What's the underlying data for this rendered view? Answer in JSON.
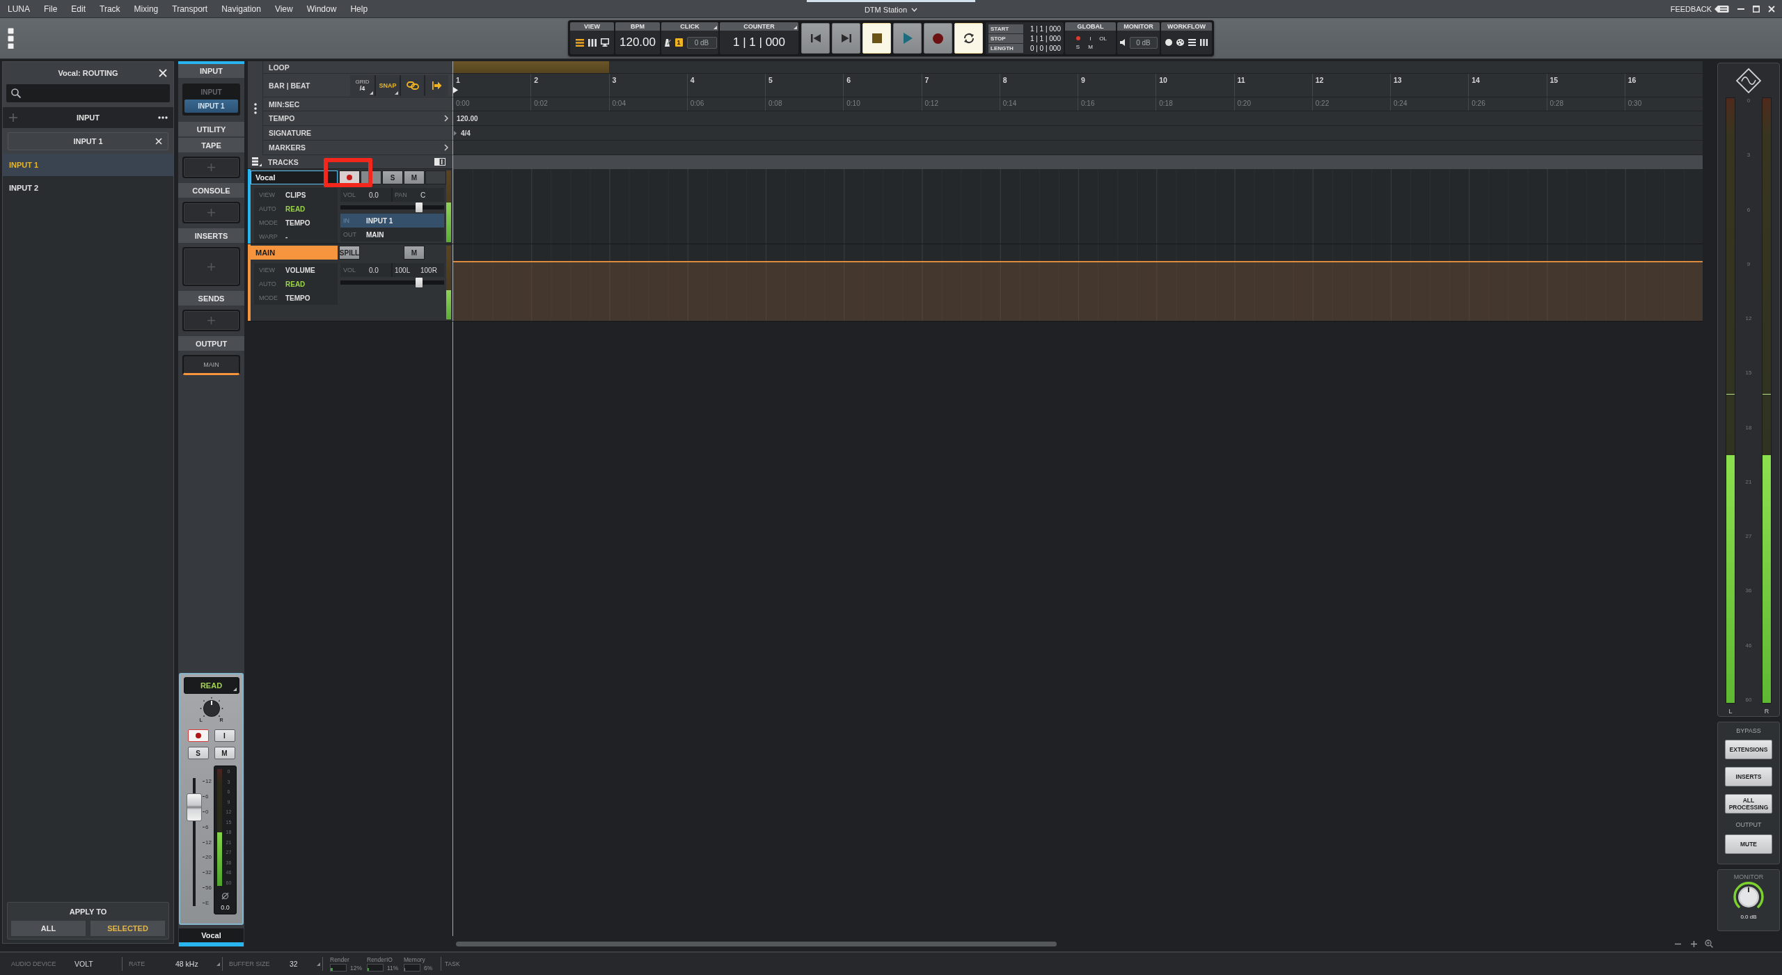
{
  "menu_bar": {
    "app": "LUNA",
    "items": [
      "File",
      "Edit",
      "Track",
      "Mixing",
      "Transport",
      "Navigation",
      "View",
      "Window",
      "Help"
    ],
    "session_title": "DTM Station",
    "feedback": "FEEDBACK"
  },
  "transport": {
    "sections": {
      "view": "VIEW",
      "bpm": "BPM",
      "click": "CLICK",
      "counter": "COUNTER",
      "global": "GLOBAL",
      "monitor": "MONITOR",
      "workflow": "WORKFLOW"
    },
    "bpm": "120.00",
    "click_count": "1",
    "click_level": "0 dB",
    "counter": "1 | 1 | 000",
    "buttons": [
      {
        "kind": "to_start",
        "on": false
      },
      {
        "kind": "to_end",
        "on": false
      },
      {
        "kind": "stop",
        "on": true
      },
      {
        "kind": "play",
        "on": false
      },
      {
        "kind": "record",
        "on": false
      },
      {
        "kind": "loop",
        "on": true
      }
    ],
    "range": [
      {
        "label": "START",
        "value": "1 | 1 | 000"
      },
      {
        "label": "STOP",
        "value": "1 | 1 | 000"
      },
      {
        "label": "LENGTH",
        "value": "0 | 0 | 000"
      }
    ],
    "global": {
      "top": [
        "I",
        "OL"
      ],
      "bottom": [
        "S",
        "M"
      ]
    },
    "monitor_level": "0 dB"
  },
  "routing": {
    "title": "Vocal: ROUTING",
    "group": "INPUT",
    "chosen": "INPUT 1",
    "items": [
      {
        "label": "INPUT 1",
        "selected": true
      },
      {
        "label": "INPUT 2",
        "selected": false
      }
    ],
    "apply_to": {
      "label": "APPLY TO",
      "options": [
        {
          "label": "ALL",
          "selected": false
        },
        {
          "label": "SELECTED",
          "selected": true
        }
      ]
    }
  },
  "inspector": {
    "sections": [
      {
        "kind": "selector",
        "title": "INPUT",
        "active": true,
        "options": [
          {
            "label": "INPUT",
            "selected": false
          },
          {
            "label": "INPUT 1",
            "selected": true
          }
        ]
      },
      {
        "kind": "header",
        "title": "UTILITY",
        "active": false
      },
      {
        "kind": "slot",
        "title": "TAPE",
        "active": false
      },
      {
        "kind": "slot",
        "title": "CONSOLE",
        "active": false
      },
      {
        "kind": "large_slot",
        "title": "INSERTS",
        "active": false
      },
      {
        "kind": "slot",
        "title": "SENDS",
        "active": false
      },
      {
        "kind": "output",
        "title": "OUTPUT",
        "active": false,
        "value": "MAIN"
      }
    ]
  },
  "channel_strip": {
    "automation": "READ",
    "pan_labels": [
      "L",
      "R"
    ],
    "buttons": [
      {
        "kind": "record"
      },
      {
        "kind": "label",
        "label": "I"
      },
      {
        "kind": "label",
        "label": "S"
      },
      {
        "kind": "label",
        "label": "M"
      }
    ],
    "fader_scale": [
      "12",
      "6",
      "0",
      "6",
      "12",
      "20",
      "32",
      "56",
      "E"
    ],
    "fader": {
      "level": 0.85
    },
    "meter_scale": [
      "0",
      "3",
      "6",
      "9",
      "12",
      "15",
      "18",
      "21",
      "27",
      "36",
      "46",
      "60"
    ],
    "meter": {
      "level": 0.46
    },
    "peak": "0.0",
    "name": "Vocal"
  },
  "ruler": {
    "rows": [
      {
        "kind": "loop",
        "label": "LOOP"
      },
      {
        "kind": "bars",
        "label": "BAR | BEAT",
        "values": [
          "1",
          "2",
          "3",
          "4",
          "5",
          "6",
          "7",
          "8",
          "9",
          "10",
          "11",
          "12",
          "13",
          "14",
          "15",
          "16"
        ]
      },
      {
        "kind": "times",
        "label": "MIN:SEC",
        "values": [
          "0:00",
          "0:02",
          "0:04",
          "0:06",
          "0:08",
          "0:10",
          "0:12",
          "0:14",
          "0:16",
          "0:18",
          "0:20",
          "0:22",
          "0:24",
          "0:26",
          "0:28",
          "0:30"
        ]
      },
      {
        "kind": "tempo",
        "label": "TEMPO",
        "values": [
          "120.00"
        ]
      },
      {
        "kind": "signature",
        "label": "SIGNATURE",
        "values": [
          "4/4"
        ]
      },
      {
        "kind": "markers",
        "label": "MARKERS"
      }
    ],
    "grid": {
      "label": "GRID",
      "value": "/4"
    },
    "snap": "SNAP"
  },
  "tracks_header": {
    "label": "TRACKS"
  },
  "tracks": [
    {
      "kind": "audio",
      "name": "Vocal",
      "color": "#29b6f0",
      "selected": true,
      "buttons": [
        {
          "kind": "record"
        },
        {
          "kind": "monitor"
        },
        {
          "kind": "solo",
          "label": "S"
        },
        {
          "kind": "mute",
          "label": "M"
        },
        {
          "kind": "blank"
        }
      ],
      "properties": [
        {
          "kind": "plain",
          "label": "VIEW",
          "value": "CLIPS"
        },
        {
          "kind": "automation",
          "label": "AUTO",
          "value": "READ"
        },
        {
          "kind": "plain",
          "label": "MODE",
          "value": "TEMPO"
        },
        {
          "kind": "plain",
          "label": "WARP",
          "value": "-"
        }
      ],
      "mix": [
        {
          "kind": "label",
          "text": "VOL"
        },
        {
          "kind": "value",
          "text": "0.0"
        },
        {
          "kind": "label",
          "text": "PAN"
        },
        {
          "kind": "value",
          "text": "C"
        }
      ],
      "volume": {
        "level": 0.78
      },
      "routing": [
        {
          "label": "IN",
          "value": "INPUT 1",
          "selected": true
        },
        {
          "label": "OUT",
          "value": "MAIN",
          "selected": false
        }
      ],
      "meter": {
        "level": 0.55
      }
    },
    {
      "kind": "main",
      "name": "MAIN",
      "color": "#f7953f",
      "selected": false,
      "buttons": [
        {
          "kind": "spill",
          "label": "SPILL"
        },
        {
          "kind": "mute",
          "label": "M"
        }
      ],
      "properties": [
        {
          "kind": "plain",
          "label": "VIEW",
          "value": "VOLUME"
        },
        {
          "kind": "automation",
          "label": "AUTO",
          "value": "READ"
        },
        {
          "kind": "plain",
          "label": "MODE",
          "value": "TEMPO"
        }
      ],
      "mix": [
        {
          "kind": "label",
          "text": "VOL"
        },
        {
          "kind": "value",
          "text": "0.0"
        },
        {
          "kind": "value",
          "text": "100L"
        },
        {
          "kind": "value",
          "text": "100R"
        }
      ],
      "volume": {
        "level": 0.78
      },
      "meter": {
        "level": 0.4
      }
    }
  ],
  "master": {
    "scale": [
      "0",
      "3",
      "6",
      "9",
      "12",
      "15",
      "18",
      "21",
      "27",
      "36",
      "46",
      "60"
    ],
    "meters": [
      {
        "label": "L",
        "level": 0.41
      },
      {
        "label": "R",
        "level": 0.41
      }
    ],
    "bypass": {
      "label": "BYPASS",
      "buttons": [
        "EXTENSIONS",
        "INSERTS",
        "ALL PROCESSING"
      ]
    },
    "output": {
      "label": "OUTPUT",
      "buttons": [
        "MUTE"
      ]
    },
    "monitor": {
      "label": "MONITOR",
      "value": "0.0 dB"
    }
  },
  "status_bar": {
    "fields": [
      {
        "kind": "plain",
        "label": "AUDIO DEVICE",
        "value": "VOLT"
      },
      {
        "kind": "dropdown",
        "label": "RATE",
        "value": "48 kHz"
      },
      {
        "kind": "dropdown",
        "label": "BUFFER SIZE",
        "value": "32"
      }
    ],
    "meters": [
      {
        "label": "Render",
        "value": "12%",
        "level": 0.12
      },
      {
        "label": "RenderIO",
        "value": "11%",
        "level": 0.11
      },
      {
        "label": "Memory",
        "value": "6%",
        "level": 0.06
      }
    ],
    "task": "TASK"
  }
}
